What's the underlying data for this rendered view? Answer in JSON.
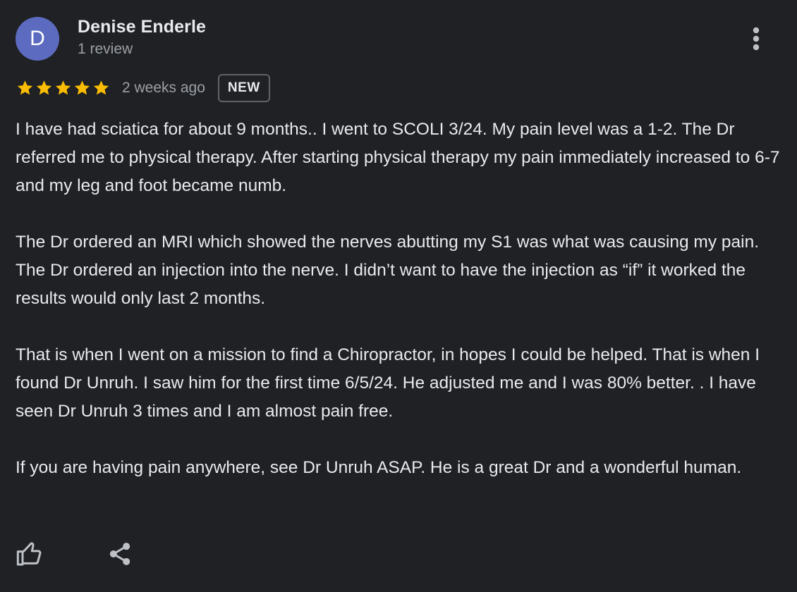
{
  "reviewer": {
    "avatar_initial": "D",
    "name": "Denise Enderle",
    "review_count": "1 review"
  },
  "rating": {
    "stars": 5,
    "max_stars": 5,
    "star_color": "#fbbc04",
    "date": "2 weeks ago",
    "badge": "NEW"
  },
  "review": {
    "paragraphs": [
      "I have had sciatica for about 9 months.. I went to SCOLI 3/24. My pain level was a 1-2. The Dr referred me to physical therapy. After starting physical therapy my pain immediately increased to 6-7 and my leg and foot became numb.",
      "The Dr ordered an MRI which showed the nerves abutting my S1 was what was causing my pain. The Dr ordered an injection into the nerve. I didn’t want to have the injection as “if” it worked the results would only last 2 months.",
      "That is when I went on a mission to find a Chiropractor, in hopes I could be helped. That is when I found Dr Unruh. I saw him for the first time 6/5/24. He adjusted me and I was 80% better. . I have seen Dr Unruh 3 times and I am almost pain free.",
      "If you are having pain anywhere, see Dr Unruh ASAP. He is a great Dr and a wonderful human."
    ]
  },
  "icons": {
    "more": "more-vert-icon",
    "like": "thumb-up-icon",
    "share": "share-icon"
  },
  "colors": {
    "background": "#202124",
    "avatar": "#5c6bc0",
    "text_primary": "#e8eaed",
    "text_secondary": "#9aa0a6"
  }
}
